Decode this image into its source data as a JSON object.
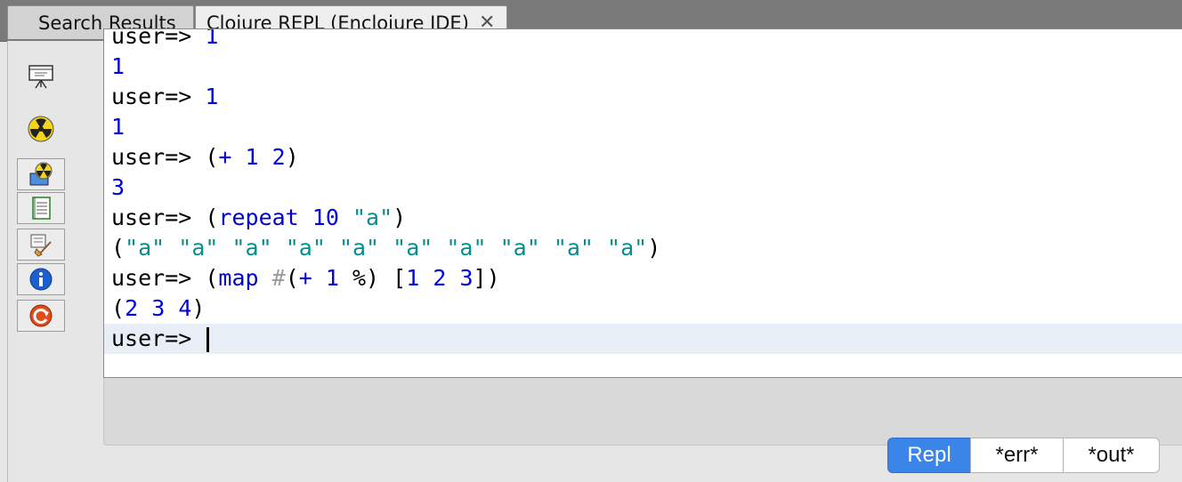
{
  "tabs": [
    {
      "label": "Search Results",
      "active": false
    },
    {
      "label": "Clojure REPL (Enclojure IDE)",
      "active": true,
      "close_glyph": "✕"
    }
  ],
  "toolbar": [
    {
      "icon": "presentation-board-icon"
    },
    {
      "icon": "radiation-icon"
    },
    {
      "icon": "radiation-monitor-icon"
    },
    {
      "icon": "notepad-icon"
    },
    {
      "icon": "clear-broom-icon"
    },
    {
      "icon": "info-icon"
    },
    {
      "icon": "reload-icon"
    }
  ],
  "repl": {
    "lines": [
      [
        {
          "t": "user=> ",
          "c": ""
        },
        {
          "t": "1",
          "c": "num"
        }
      ],
      [
        {
          "t": "1",
          "c": "num"
        }
      ],
      [
        {
          "t": "user=> ",
          "c": ""
        },
        {
          "t": "1",
          "c": "num"
        }
      ],
      [
        {
          "t": "1",
          "c": "num"
        }
      ],
      [
        {
          "t": "user=> (",
          "c": ""
        },
        {
          "t": "+",
          "c": "fn"
        },
        {
          "t": " ",
          "c": ""
        },
        {
          "t": "1",
          "c": "num"
        },
        {
          "t": " ",
          "c": ""
        },
        {
          "t": "2",
          "c": "num"
        },
        {
          "t": ")",
          "c": ""
        }
      ],
      [
        {
          "t": "3",
          "c": "num"
        }
      ],
      [
        {
          "t": "user=> (",
          "c": ""
        },
        {
          "t": "repeat",
          "c": "fn"
        },
        {
          "t": " ",
          "c": ""
        },
        {
          "t": "10",
          "c": "num"
        },
        {
          "t": " ",
          "c": ""
        },
        {
          "t": "\"a\"",
          "c": "str"
        },
        {
          "t": ")",
          "c": ""
        }
      ],
      [
        {
          "t": "(",
          "c": ""
        },
        {
          "t": "\"a\"",
          "c": "str"
        },
        {
          "t": " ",
          "c": ""
        },
        {
          "t": "\"a\"",
          "c": "str"
        },
        {
          "t": " ",
          "c": ""
        },
        {
          "t": "\"a\"",
          "c": "str"
        },
        {
          "t": " ",
          "c": ""
        },
        {
          "t": "\"a\"",
          "c": "str"
        },
        {
          "t": " ",
          "c": ""
        },
        {
          "t": "\"a\"",
          "c": "str"
        },
        {
          "t": " ",
          "c": ""
        },
        {
          "t": "\"a\"",
          "c": "str"
        },
        {
          "t": " ",
          "c": ""
        },
        {
          "t": "\"a\"",
          "c": "str"
        },
        {
          "t": " ",
          "c": ""
        },
        {
          "t": "\"a\"",
          "c": "str"
        },
        {
          "t": " ",
          "c": ""
        },
        {
          "t": "\"a\"",
          "c": "str"
        },
        {
          "t": " ",
          "c": ""
        },
        {
          "t": "\"a\"",
          "c": "str"
        },
        {
          "t": ")",
          "c": ""
        }
      ],
      [
        {
          "t": "user=> (",
          "c": ""
        },
        {
          "t": "map",
          "c": "fn"
        },
        {
          "t": " ",
          "c": ""
        },
        {
          "t": "#",
          "c": "dim"
        },
        {
          "t": "(",
          "c": ""
        },
        {
          "t": "+",
          "c": "fn"
        },
        {
          "t": " ",
          "c": ""
        },
        {
          "t": "1",
          "c": "num"
        },
        {
          "t": " %) [",
          "c": ""
        },
        {
          "t": "1",
          "c": "num"
        },
        {
          "t": " ",
          "c": ""
        },
        {
          "t": "2",
          "c": "num"
        },
        {
          "t": " ",
          "c": ""
        },
        {
          "t": "3",
          "c": "num"
        },
        {
          "t": "])",
          "c": ""
        }
      ],
      [
        {
          "t": "(",
          "c": ""
        },
        {
          "t": "2",
          "c": "num"
        },
        {
          "t": " ",
          "c": ""
        },
        {
          "t": "3",
          "c": "num"
        },
        {
          "t": " ",
          "c": ""
        },
        {
          "t": "4",
          "c": "num"
        },
        {
          "t": ")",
          "c": ""
        }
      ]
    ],
    "prompt": "user=> "
  },
  "view_tabs": [
    {
      "label": "Repl",
      "selected": true
    },
    {
      "label": "*err*",
      "selected": false
    },
    {
      "label": "*out*",
      "selected": false
    }
  ],
  "colors": {
    "number": "#0000e6",
    "function": "#0000c8",
    "string": "#009090",
    "selected_segment": "#3b84e8"
  }
}
